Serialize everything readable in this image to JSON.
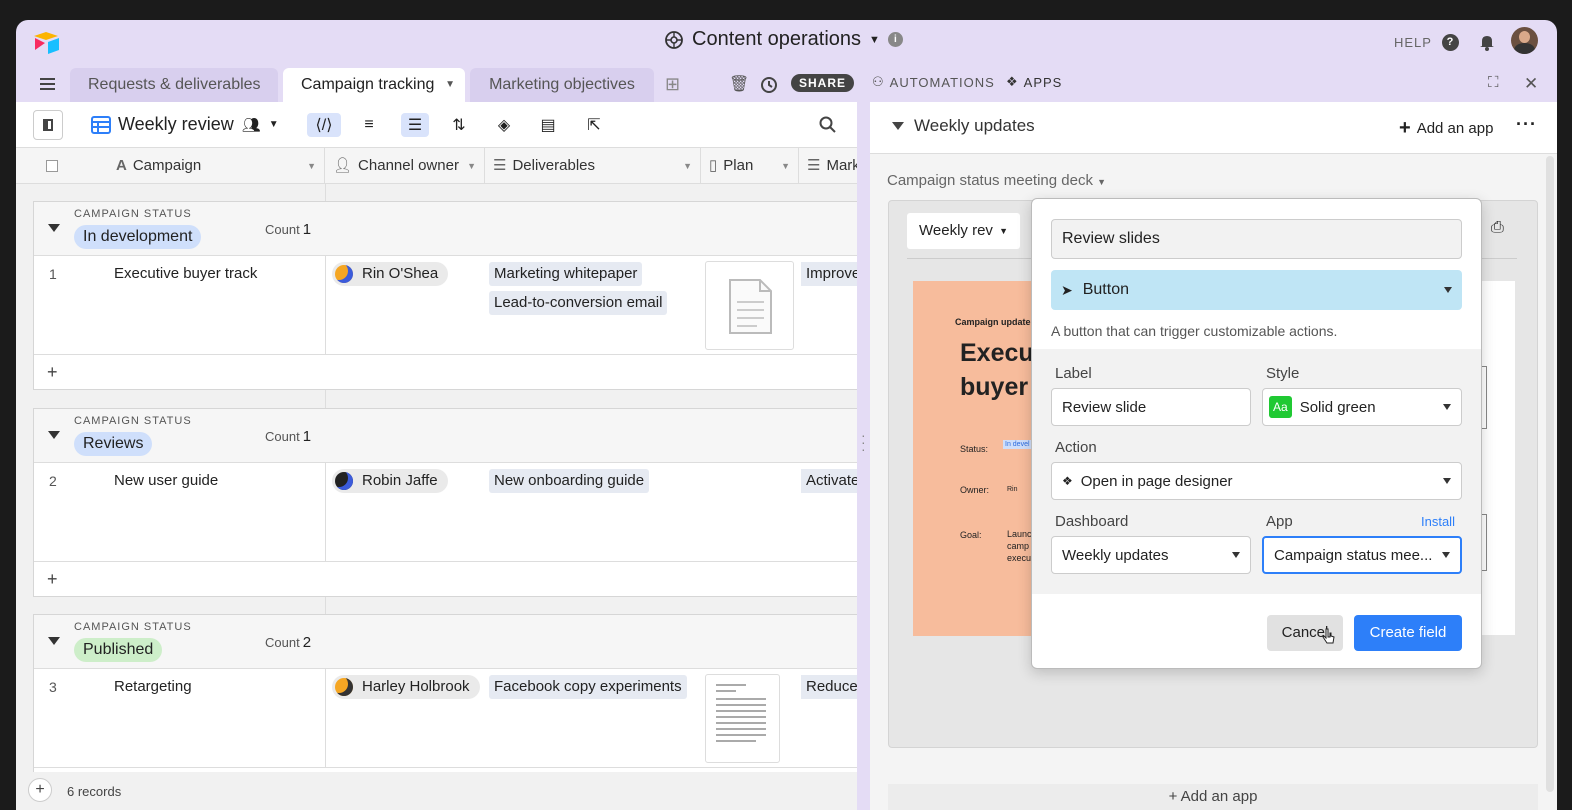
{
  "app": {
    "base_title": "Content operations",
    "help": "HELP"
  },
  "tabs": [
    {
      "label": "Requests & deliverables"
    },
    {
      "label": "Campaign tracking"
    },
    {
      "label": "Marketing objectives"
    }
  ],
  "toolbar": {
    "share": "SHARE",
    "automations": "AUTOMATIONS",
    "apps": "APPS"
  },
  "view": {
    "name": "Weekly review"
  },
  "columns": [
    "Campaign",
    "Channel owner",
    "Deliverables",
    "Plan",
    "Mark"
  ],
  "groups": [
    {
      "caption": "CAMPAIGN STATUS",
      "status": "In development",
      "status_color": "#cfdffb",
      "count_label": "Count",
      "count": "1",
      "rows": [
        {
          "num": "1",
          "campaign": "Executive buyer track",
          "owner": "Rin O'Shea",
          "deliverables": [
            "Marketing whitepaper",
            "Lead-to-conversion email"
          ],
          "marketing": "Improve"
        }
      ]
    },
    {
      "caption": "CAMPAIGN STATUS",
      "status": "Reviews",
      "status_color": "#cfdffb",
      "count_label": "Count",
      "count": "1",
      "rows": [
        {
          "num": "2",
          "campaign": "New user guide",
          "owner": "Robin Jaffe",
          "deliverables": [
            "New onboarding guide"
          ],
          "marketing": "Activate"
        }
      ]
    },
    {
      "caption": "CAMPAIGN STATUS",
      "status": "Published",
      "status_color": "#cdeec9",
      "count_label": "Count",
      "count": "2",
      "rows": [
        {
          "num": "3",
          "campaign": "Retargeting",
          "owner": "Harley Holbrook",
          "deliverables": [
            "Facebook copy experiments"
          ],
          "marketing": "Reduce"
        }
      ]
    }
  ],
  "add_row": "+",
  "footer": {
    "records": "6 records",
    "add": "+"
  },
  "dashboard": {
    "title": "Weekly updates",
    "add_app": "Add an app",
    "app_caption": "Campaign status meeting deck",
    "view_select": "Weekly rev",
    "bottom_add_app": "Add an app"
  },
  "slide": {
    "small": "Campaign update",
    "big": "Execut\nbuyer t",
    "status_label": "Status:",
    "status_val": "In devel",
    "owner_label": "Owner:",
    "owner_val": "Rin",
    "goal_label": "Goal:",
    "goal_val": "Launc\ncamp\nexecu"
  },
  "modal": {
    "name_value": "Review slides",
    "type": "Button",
    "description": "A button that can trigger customizable actions.",
    "label_label": "Label",
    "label_value": "Review slide",
    "style_label": "Style",
    "style_value": "Solid green",
    "style_badge": "Aa",
    "action_label": "Action",
    "action_value": "Open in page designer",
    "dashboard_label": "Dashboard",
    "dashboard_value": "Weekly updates",
    "app_label": "App",
    "install": "Install",
    "app_value": "Campaign status mee...",
    "cancel": "Cancel",
    "create": "Create field"
  },
  "colors": {
    "accent": "#2d7ff9",
    "selected_tab_bg": "#ffffff",
    "type_bar": "#bfe5f5"
  }
}
